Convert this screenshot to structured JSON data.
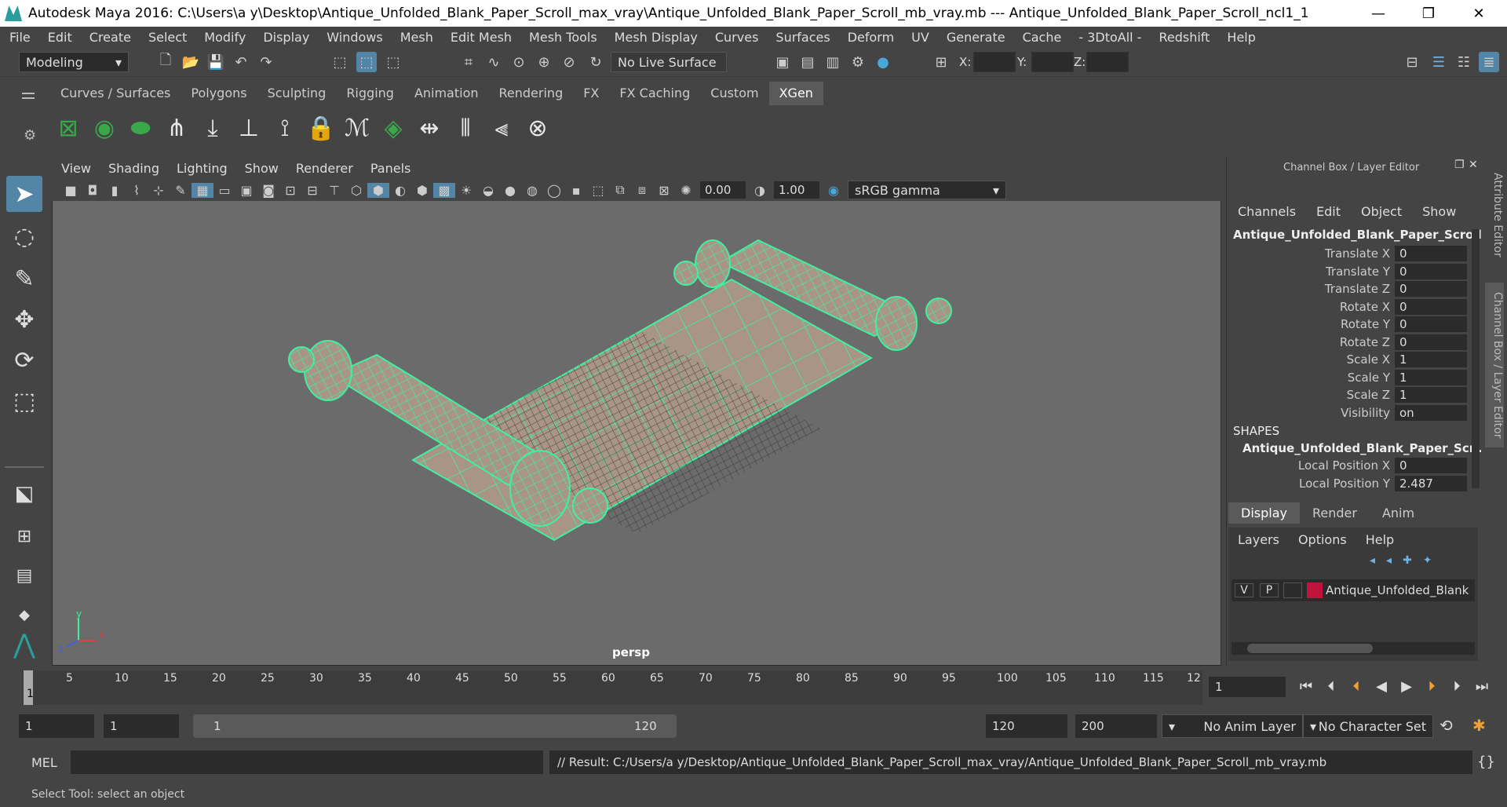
{
  "window": {
    "title": "Autodesk Maya 2016: C:\\Users\\a y\\Desktop\\Antique_Unfolded_Blank_Paper_Scroll_max_vray\\Antique_Unfolded_Blank_Paper_Scroll_mb_vray.mb   ---   Antique_Unfolded_Blank_Paper_Scroll_ncl1_1",
    "minimize": "—",
    "maximize": "❐",
    "close": "✕"
  },
  "menubar": [
    "File",
    "Edit",
    "Create",
    "Select",
    "Modify",
    "Display",
    "Windows",
    "Mesh",
    "Edit Mesh",
    "Mesh Tools",
    "Mesh Display",
    "Curves",
    "Surfaces",
    "Deform",
    "UV",
    "Generate",
    "Cache",
    "- 3DtoAll -",
    "Redshift",
    "Help"
  ],
  "statusline": {
    "mode": "Modeling",
    "live_surface": "No Live Surface",
    "x_label": "X:",
    "y_label": "Y:",
    "z_label": "Z:"
  },
  "shelf": {
    "tabs": [
      "Curves / Surfaces",
      "Polygons",
      "Sculpting",
      "Rigging",
      "Animation",
      "Rendering",
      "FX",
      "FX Caching",
      "Custom",
      "XGen"
    ],
    "active_tab": "XGen"
  },
  "viewport": {
    "menu": [
      "View",
      "Shading",
      "Lighting",
      "Show",
      "Renderer",
      "Panels"
    ],
    "exposure": "0.00",
    "gamma": "1.00",
    "color_space": "sRGB gamma",
    "camera_label": "persp",
    "axis_y": "y",
    "axis_x": "x",
    "axis_z": "z"
  },
  "channel_box": {
    "title": "Channel Box / Layer Editor",
    "menu": [
      "Channels",
      "Edit",
      "Object",
      "Show"
    ],
    "object_name": "Antique_Unfolded_Blank_Paper_Scroll...",
    "attributes": [
      {
        "label": "Translate X",
        "value": "0"
      },
      {
        "label": "Translate Y",
        "value": "0"
      },
      {
        "label": "Translate Z",
        "value": "0"
      },
      {
        "label": "Rotate X",
        "value": "0"
      },
      {
        "label": "Rotate Y",
        "value": "0"
      },
      {
        "label": "Rotate Z",
        "value": "0"
      },
      {
        "label": "Scale X",
        "value": "1"
      },
      {
        "label": "Scale Y",
        "value": "1"
      },
      {
        "label": "Scale Z",
        "value": "1"
      },
      {
        "label": "Visibility",
        "value": "on"
      }
    ],
    "shapes_header": "SHAPES",
    "shape_name": "Antique_Unfolded_Blank_Paper_Scr...",
    "shape_attributes": [
      {
        "label": "Local Position X",
        "value": "0"
      },
      {
        "label": "Local Position Y",
        "value": "2.487"
      }
    ]
  },
  "layer_editor": {
    "tabs": [
      "Display",
      "Render",
      "Anim"
    ],
    "active_tab": "Display",
    "menu": [
      "Layers",
      "Options",
      "Help"
    ],
    "layer": {
      "v": "V",
      "p": "P",
      "name": "Antique_Unfolded_Blank",
      "color": "#c0143c"
    }
  },
  "side_tabs": {
    "attribute_editor": "Attribute Editor",
    "channel_box": "Channel Box / Layer Editor"
  },
  "timeline": {
    "ticks": [
      "5",
      "10",
      "15",
      "20",
      "25",
      "30",
      "35",
      "40",
      "45",
      "50",
      "55",
      "60",
      "65",
      "70",
      "75",
      "80",
      "85",
      "90",
      "95",
      "100",
      "105",
      "110",
      "115",
      "12"
    ],
    "current_marker": "1",
    "current_frame": "1"
  },
  "range": {
    "start": "1",
    "playback_start": "1",
    "slider_start": "1",
    "slider_end": "120",
    "playback_end": "120",
    "end": "200",
    "anim_layer": "No Anim Layer",
    "character_set": "No Character Set"
  },
  "command": {
    "language": "MEL",
    "result": "// Result: C:/Users/a y/Desktop/Antique_Unfolded_Blank_Paper_Scroll_max_vray/Antique_Unfolded_Blank_Paper_Scroll_mb_vray.mb"
  },
  "help_line": "Select Tool: select an object",
  "colors": {
    "wireframe": "#3ff0a0",
    "paper": "#a89585",
    "viewport_bg": "#6b6b6b",
    "accent": "#5285a6"
  }
}
